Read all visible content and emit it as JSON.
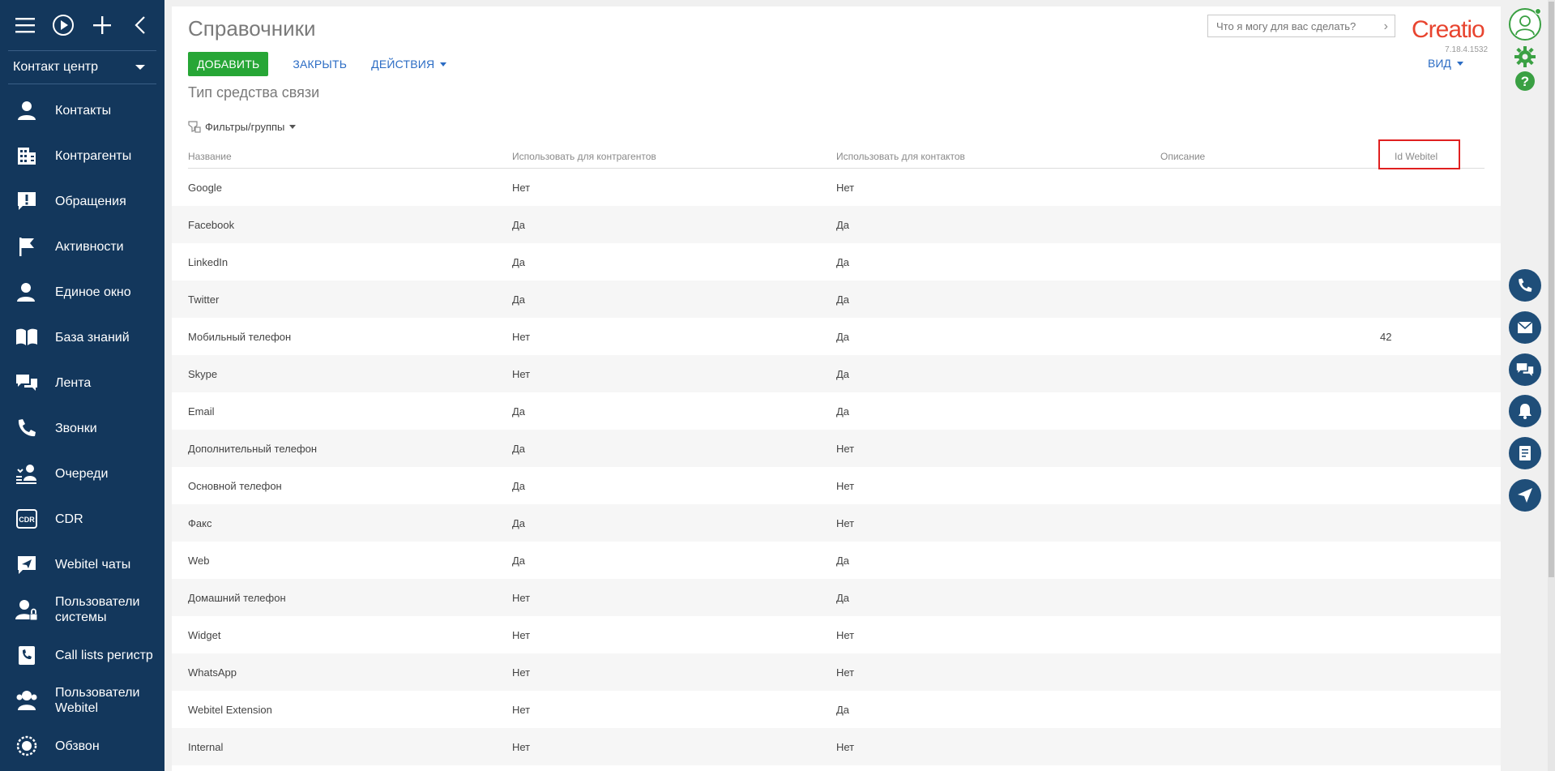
{
  "sidebar": {
    "workplace": "Контакт центр",
    "items": [
      {
        "label": "Контакты",
        "icon": "contact-icon"
      },
      {
        "label": "Контрагенты",
        "icon": "building-icon"
      },
      {
        "label": "Обращения",
        "icon": "alert-bubble-icon"
      },
      {
        "label": "Активности",
        "icon": "flag-icon"
      },
      {
        "label": "Единое окно",
        "icon": "headset-user-icon"
      },
      {
        "label": "База знаний",
        "icon": "book-icon"
      },
      {
        "label": "Лента",
        "icon": "feed-icon"
      },
      {
        "label": "Звонки",
        "icon": "phone-icon"
      },
      {
        "label": "Очереди",
        "icon": "queue-icon"
      },
      {
        "label": "CDR",
        "icon": "cdr-icon"
      },
      {
        "label": "Webitel чаты",
        "icon": "chat-send-icon"
      },
      {
        "label": "Пользователи системы",
        "icon": "system-users-icon"
      },
      {
        "label": "Call lists регистр",
        "icon": "call-list-icon"
      },
      {
        "label": "Пользователи Webitel",
        "icon": "webitel-users-icon"
      },
      {
        "label": "Обзвон",
        "icon": "dial-icon"
      }
    ]
  },
  "header": {
    "title": "Справочники",
    "search_placeholder": "Что я могу для вас сделать?",
    "logo_text": "Creatio",
    "version": "7.18.4.1532"
  },
  "toolbar": {
    "add_label": "ДОБАВИТЬ",
    "close_label": "ЗАКРЫТЬ",
    "actions_label": "ДЕЙСТВИЯ",
    "view_label": "ВИД"
  },
  "section": {
    "title": "Тип средства связи",
    "filters_label": "Фильтры/группы"
  },
  "grid": {
    "columns": [
      "Название",
      "Использовать для контрагентов",
      "Использовать для контактов",
      "Описание",
      "Id Webitel"
    ],
    "rows": [
      [
        "Google",
        "Нет",
        "Нет",
        "",
        ""
      ],
      [
        "Facebook",
        "Да",
        "Да",
        "",
        ""
      ],
      [
        "LinkedIn",
        "Да",
        "Да",
        "",
        ""
      ],
      [
        "Twitter",
        "Да",
        "Да",
        "",
        ""
      ],
      [
        "Мобильный телефон",
        "Нет",
        "Да",
        "",
        "42"
      ],
      [
        "Skype",
        "Нет",
        "Да",
        "",
        ""
      ],
      [
        "Email",
        "Да",
        "Да",
        "",
        ""
      ],
      [
        "Дополнительный телефон",
        "Да",
        "Нет",
        "",
        ""
      ],
      [
        "Основной телефон",
        "Да",
        "Нет",
        "",
        ""
      ],
      [
        "Факс",
        "Да",
        "Нет",
        "",
        ""
      ],
      [
        "Web",
        "Да",
        "Да",
        "",
        ""
      ],
      [
        "Домашний телефон",
        "Нет",
        "Да",
        "",
        ""
      ],
      [
        "Widget",
        "Нет",
        "Нет",
        "",
        ""
      ],
      [
        "WhatsApp",
        "Нет",
        "Нет",
        "",
        ""
      ],
      [
        "Webitel Extension",
        "Нет",
        "Да",
        "",
        ""
      ],
      [
        "Internal",
        "Нет",
        "Нет",
        "",
        ""
      ]
    ]
  },
  "colors": {
    "sidebar_bg": "#13375c",
    "accent_green": "#27a636",
    "link_blue": "#2b6cc4",
    "logo_red": "#e8442f",
    "highlight_red": "#e02020",
    "rightbar_button": "#1f4e79"
  }
}
